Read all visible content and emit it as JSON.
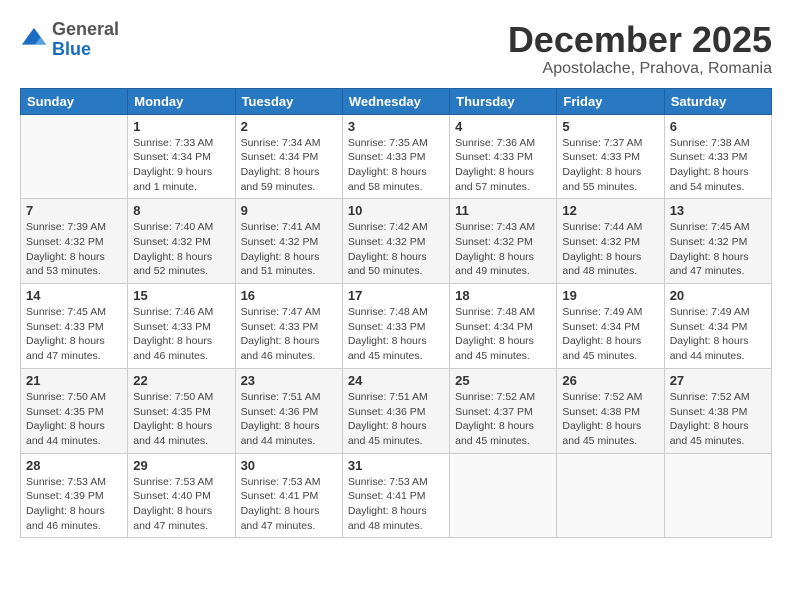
{
  "header": {
    "logo_general": "General",
    "logo_blue": "Blue",
    "month_title": "December 2025",
    "location": "Apostolache, Prahova, Romania"
  },
  "days_of_week": [
    "Sunday",
    "Monday",
    "Tuesday",
    "Wednesday",
    "Thursday",
    "Friday",
    "Saturday"
  ],
  "weeks": [
    [
      {
        "day": "",
        "sunrise": "",
        "sunset": "",
        "daylight": ""
      },
      {
        "day": "1",
        "sunrise": "Sunrise: 7:33 AM",
        "sunset": "Sunset: 4:34 PM",
        "daylight": "Daylight: 9 hours and 1 minute."
      },
      {
        "day": "2",
        "sunrise": "Sunrise: 7:34 AM",
        "sunset": "Sunset: 4:34 PM",
        "daylight": "Daylight: 8 hours and 59 minutes."
      },
      {
        "day": "3",
        "sunrise": "Sunrise: 7:35 AM",
        "sunset": "Sunset: 4:33 PM",
        "daylight": "Daylight: 8 hours and 58 minutes."
      },
      {
        "day": "4",
        "sunrise": "Sunrise: 7:36 AM",
        "sunset": "Sunset: 4:33 PM",
        "daylight": "Daylight: 8 hours and 57 minutes."
      },
      {
        "day": "5",
        "sunrise": "Sunrise: 7:37 AM",
        "sunset": "Sunset: 4:33 PM",
        "daylight": "Daylight: 8 hours and 55 minutes."
      },
      {
        "day": "6",
        "sunrise": "Sunrise: 7:38 AM",
        "sunset": "Sunset: 4:33 PM",
        "daylight": "Daylight: 8 hours and 54 minutes."
      }
    ],
    [
      {
        "day": "7",
        "sunrise": "Sunrise: 7:39 AM",
        "sunset": "Sunset: 4:32 PM",
        "daylight": "Daylight: 8 hours and 53 minutes."
      },
      {
        "day": "8",
        "sunrise": "Sunrise: 7:40 AM",
        "sunset": "Sunset: 4:32 PM",
        "daylight": "Daylight: 8 hours and 52 minutes."
      },
      {
        "day": "9",
        "sunrise": "Sunrise: 7:41 AM",
        "sunset": "Sunset: 4:32 PM",
        "daylight": "Daylight: 8 hours and 51 minutes."
      },
      {
        "day": "10",
        "sunrise": "Sunrise: 7:42 AM",
        "sunset": "Sunset: 4:32 PM",
        "daylight": "Daylight: 8 hours and 50 minutes."
      },
      {
        "day": "11",
        "sunrise": "Sunrise: 7:43 AM",
        "sunset": "Sunset: 4:32 PM",
        "daylight": "Daylight: 8 hours and 49 minutes."
      },
      {
        "day": "12",
        "sunrise": "Sunrise: 7:44 AM",
        "sunset": "Sunset: 4:32 PM",
        "daylight": "Daylight: 8 hours and 48 minutes."
      },
      {
        "day": "13",
        "sunrise": "Sunrise: 7:45 AM",
        "sunset": "Sunset: 4:32 PM",
        "daylight": "Daylight: 8 hours and 47 minutes."
      }
    ],
    [
      {
        "day": "14",
        "sunrise": "Sunrise: 7:45 AM",
        "sunset": "Sunset: 4:33 PM",
        "daylight": "Daylight: 8 hours and 47 minutes."
      },
      {
        "day": "15",
        "sunrise": "Sunrise: 7:46 AM",
        "sunset": "Sunset: 4:33 PM",
        "daylight": "Daylight: 8 hours and 46 minutes."
      },
      {
        "day": "16",
        "sunrise": "Sunrise: 7:47 AM",
        "sunset": "Sunset: 4:33 PM",
        "daylight": "Daylight: 8 hours and 46 minutes."
      },
      {
        "day": "17",
        "sunrise": "Sunrise: 7:48 AM",
        "sunset": "Sunset: 4:33 PM",
        "daylight": "Daylight: 8 hours and 45 minutes."
      },
      {
        "day": "18",
        "sunrise": "Sunrise: 7:48 AM",
        "sunset": "Sunset: 4:34 PM",
        "daylight": "Daylight: 8 hours and 45 minutes."
      },
      {
        "day": "19",
        "sunrise": "Sunrise: 7:49 AM",
        "sunset": "Sunset: 4:34 PM",
        "daylight": "Daylight: 8 hours and 45 minutes."
      },
      {
        "day": "20",
        "sunrise": "Sunrise: 7:49 AM",
        "sunset": "Sunset: 4:34 PM",
        "daylight": "Daylight: 8 hours and 44 minutes."
      }
    ],
    [
      {
        "day": "21",
        "sunrise": "Sunrise: 7:50 AM",
        "sunset": "Sunset: 4:35 PM",
        "daylight": "Daylight: 8 hours and 44 minutes."
      },
      {
        "day": "22",
        "sunrise": "Sunrise: 7:50 AM",
        "sunset": "Sunset: 4:35 PM",
        "daylight": "Daylight: 8 hours and 44 minutes."
      },
      {
        "day": "23",
        "sunrise": "Sunrise: 7:51 AM",
        "sunset": "Sunset: 4:36 PM",
        "daylight": "Daylight: 8 hours and 44 minutes."
      },
      {
        "day": "24",
        "sunrise": "Sunrise: 7:51 AM",
        "sunset": "Sunset: 4:36 PM",
        "daylight": "Daylight: 8 hours and 45 minutes."
      },
      {
        "day": "25",
        "sunrise": "Sunrise: 7:52 AM",
        "sunset": "Sunset: 4:37 PM",
        "daylight": "Daylight: 8 hours and 45 minutes."
      },
      {
        "day": "26",
        "sunrise": "Sunrise: 7:52 AM",
        "sunset": "Sunset: 4:38 PM",
        "daylight": "Daylight: 8 hours and 45 minutes."
      },
      {
        "day": "27",
        "sunrise": "Sunrise: 7:52 AM",
        "sunset": "Sunset: 4:38 PM",
        "daylight": "Daylight: 8 hours and 45 minutes."
      }
    ],
    [
      {
        "day": "28",
        "sunrise": "Sunrise: 7:53 AM",
        "sunset": "Sunset: 4:39 PM",
        "daylight": "Daylight: 8 hours and 46 minutes."
      },
      {
        "day": "29",
        "sunrise": "Sunrise: 7:53 AM",
        "sunset": "Sunset: 4:40 PM",
        "daylight": "Daylight: 8 hours and 47 minutes."
      },
      {
        "day": "30",
        "sunrise": "Sunrise: 7:53 AM",
        "sunset": "Sunset: 4:41 PM",
        "daylight": "Daylight: 8 hours and 47 minutes."
      },
      {
        "day": "31",
        "sunrise": "Sunrise: 7:53 AM",
        "sunset": "Sunset: 4:41 PM",
        "daylight": "Daylight: 8 hours and 48 minutes."
      },
      {
        "day": "",
        "sunrise": "",
        "sunset": "",
        "daylight": ""
      },
      {
        "day": "",
        "sunrise": "",
        "sunset": "",
        "daylight": ""
      },
      {
        "day": "",
        "sunrise": "",
        "sunset": "",
        "daylight": ""
      }
    ]
  ]
}
